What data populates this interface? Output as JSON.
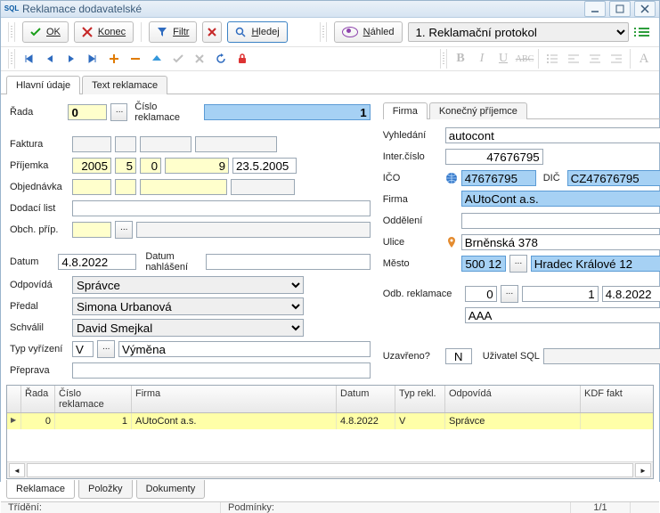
{
  "window": {
    "title": "Reklamace dodavatelské",
    "logo": "SQL"
  },
  "toolbar": {
    "ok": "OK",
    "konec": "Konec",
    "filtr": "Filtr",
    "hledej": "Hledej",
    "nahled": "Náhled",
    "template": "1. Reklamační protokol"
  },
  "tabs": {
    "main": "Hlavní údaje",
    "text": "Text reklamace"
  },
  "left": {
    "rada_lbl": "Řada",
    "rada": "0",
    "cislo_lbl": "Číslo reklamace",
    "cislo": "1",
    "faktura_lbl": "Faktura",
    "prijemka_lbl": "Příjemka",
    "prijemka_rok": "2005",
    "prijemka_a": "5",
    "prijemka_b": "0",
    "prijemka_c": "9",
    "prijemka_datum": "23.5.2005",
    "objednavka_lbl": "Objednávka",
    "dodaci_lbl": "Dodací list",
    "obch_lbl": "Obch. příp.",
    "datum_lbl": "Datum",
    "datum": "4.8.2022",
    "nahlaseni_lbl": "Datum nahlášení",
    "odpovida_lbl": "Odpovídá",
    "odpovida": "Správce",
    "predal_lbl": "Předal",
    "predal": "Simona Urbanová",
    "schvalil_lbl": "Schválil",
    "schvalil": "David Smejkal",
    "typ_lbl": "Typ vyřízení",
    "typ_kod": "V",
    "typ_txt": "Výměna",
    "preprava_lbl": "Přeprava"
  },
  "right": {
    "tab_firma": "Firma",
    "tab_konecny": "Konečný příjemce",
    "vyhledani_lbl": "Vyhledání",
    "vyhledani": "autocont",
    "inter_lbl": "Inter.číslo",
    "inter": "47676795",
    "ico_lbl": "IČO",
    "ico": "47676795",
    "dic_lbl": "DIČ",
    "dic": "CZ47676795",
    "firma_lbl": "Firma",
    "firma": "AUtoCont a.s.",
    "oddeleni_lbl": "Oddělení",
    "ulice_lbl": "Ulice",
    "ulice": "Brněnská 378",
    "mesto_lbl": "Město",
    "psc": "500 12",
    "mesto": "Hradec Králové 12",
    "odb_lbl": "Odb. reklamace",
    "odb_a": "0",
    "odb_b": "1",
    "odb_datum": "4.8.2022",
    "odb_c": "AAA",
    "uzavreno_lbl": "Uzavřeno?",
    "uzavreno": "N",
    "uzivatel_lbl": "Uživatel SQL"
  },
  "grid": {
    "h0": "",
    "h1": "Řada",
    "h2": "Číslo reklamace",
    "h3": "Firma",
    "h4": "Datum",
    "h5": "Typ rekl.",
    "h6": "Odpovídá",
    "h7": "KDF fakt",
    "r": {
      "mark": "▶",
      "rada": "0",
      "cislo": "1",
      "firma": "AUtoCont a.s.",
      "datum": "4.8.2022",
      "typ": "V",
      "odpovida": "Správce",
      "kdf": ""
    }
  },
  "btabs": {
    "a": "Reklamace",
    "b": "Položky",
    "c": "Dokumenty"
  },
  "status": {
    "trideni": "Třídění:",
    "podminky": "Podmínky:",
    "pager": "1/1"
  }
}
